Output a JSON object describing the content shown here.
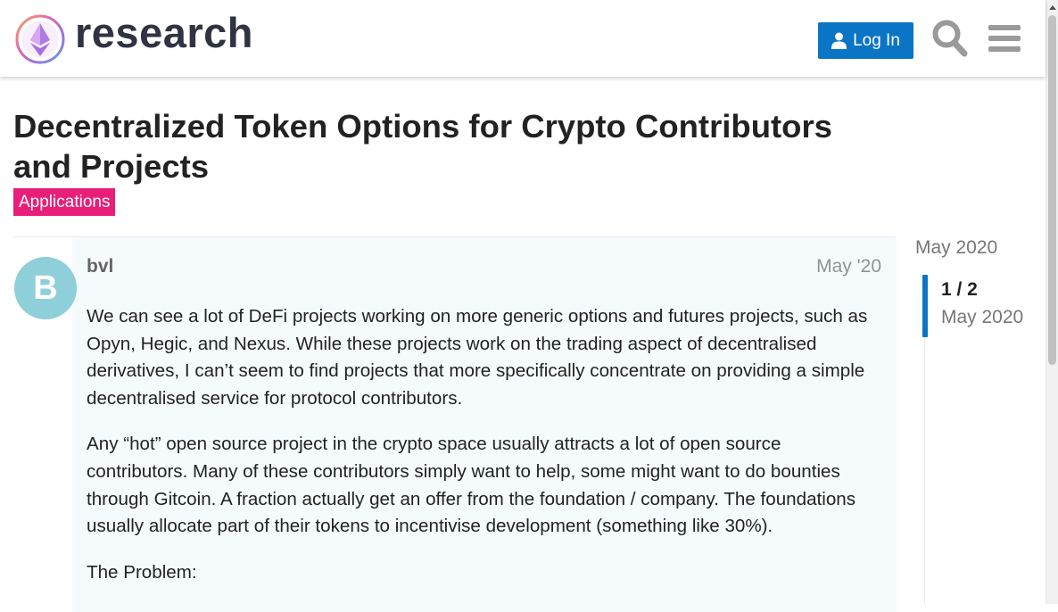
{
  "header": {
    "site_name": "research",
    "login_label": "Log In"
  },
  "topic": {
    "title": "Decentralized Token Options for Crypto Contributors and Projects",
    "category": "Applications",
    "category_color": "#e91e79"
  },
  "post": {
    "avatar_letter": "B",
    "avatar_color": "#8fcfd9",
    "username": "bvl",
    "date": "May '20",
    "paragraphs": [
      "We can see a lot of DeFi projects working on more generic options and futures projects, such as Opyn, Hegic, and Nexus. While these projects work on the trading aspect of decentralised derivatives, I can’t seem to find projects that more specifically concentrate on providing a simple decentralised service for protocol contributors.",
      "Any “hot” open source project in the crypto space usually attracts a lot of open source contributors. Many of these contributors simply want to help, some might want to do bounties through Gitcoin. A fraction actually get an offer from the foundation / company. The foundations usually allocate part of their tokens to incentivise development (something like 30%).",
      "The Problem:"
    ]
  },
  "timeline": {
    "start_date": "May 2020",
    "position": "1 / 2",
    "current_date": "May 2020"
  },
  "colors": {
    "accent": "#0a75c4",
    "post_background": "#f5fbfd"
  }
}
